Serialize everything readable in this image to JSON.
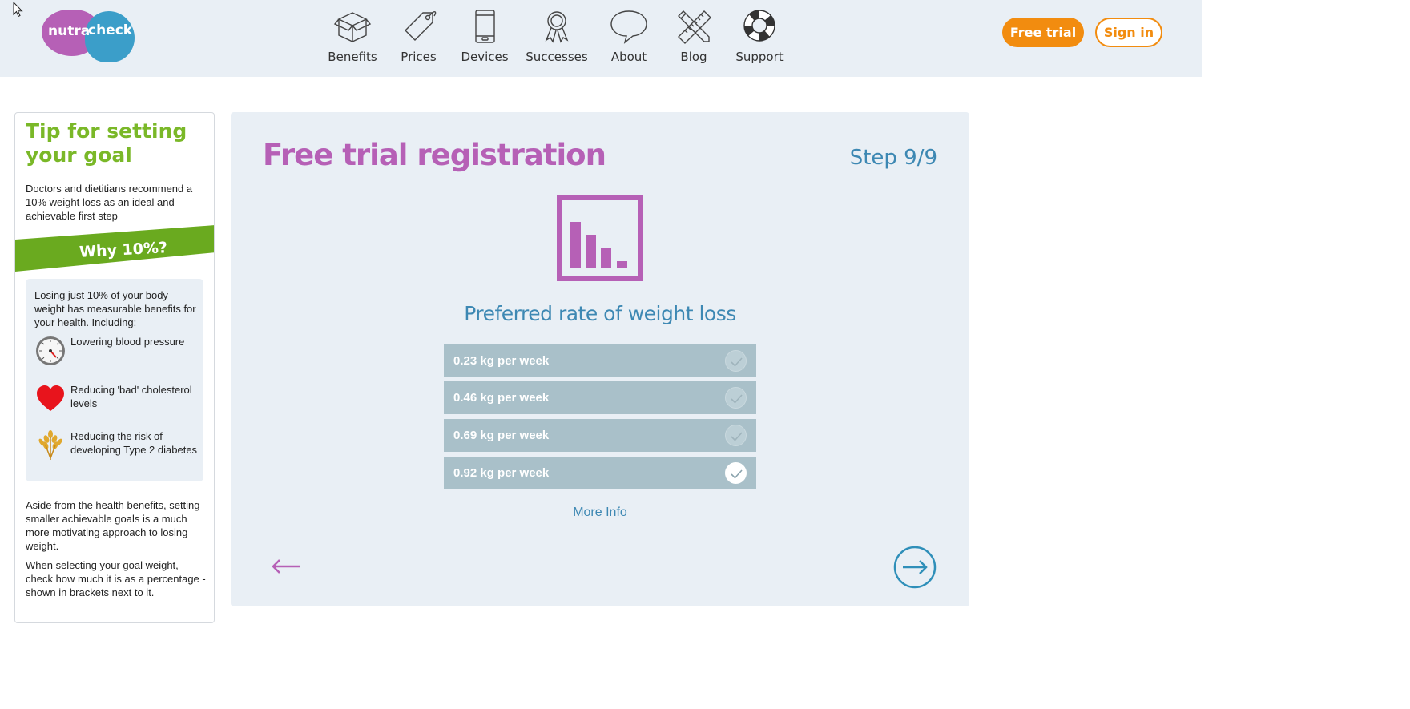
{
  "logo": {
    "part1": "nutra",
    "part2": "check"
  },
  "nav": [
    {
      "label": "Benefits",
      "icon": "box-icon"
    },
    {
      "label": "Prices",
      "icon": "price-tag-icon"
    },
    {
      "label": "Devices",
      "icon": "phone-icon"
    },
    {
      "label": "Successes",
      "icon": "rosette-icon"
    },
    {
      "label": "About",
      "icon": "speech-bubble-icon"
    },
    {
      "label": "Blog",
      "icon": "pencil-ruler-icon"
    },
    {
      "label": "Support",
      "icon": "lifebuoy-icon"
    }
  ],
  "header_buttons": {
    "free_trial": "Free trial",
    "sign_in": "Sign in"
  },
  "tip": {
    "title": "Tip for setting your goal",
    "intro": "Doctors and dietitians recommend a 10% weight loss as an ideal and achievable first step",
    "why": "Why 10%?",
    "benefits_intro": "Losing just 10% of your body weight has measurable benefits for your health. Including:",
    "benefits": [
      {
        "text": "Lowering blood pressure",
        "icon": "blood-pressure-gauge-icon"
      },
      {
        "text": "Reducing 'bad' cholesterol levels",
        "icon": "heart-icon"
      },
      {
        "text": "Reducing the risk of developing Type 2 diabetes",
        "icon": "wheat-icon"
      }
    ],
    "outro1": "Aside from the health benefits, setting smaller achievable goals is a much more motivating approach to losing weight.",
    "outro2": "When selecting your goal weight, check how much it is as a percentage - shown in brackets next to it."
  },
  "registration": {
    "title": "Free trial registration",
    "step": "Step 9/9",
    "question": "Preferred rate of weight loss",
    "options": [
      {
        "label": "0.23 kg per week",
        "selected": false
      },
      {
        "label": "0.46 kg per week",
        "selected": false
      },
      {
        "label": "0.69 kg per week",
        "selected": false
      },
      {
        "label": "0.92 kg per week",
        "selected": true
      }
    ],
    "more_info": "More Info"
  },
  "colors": {
    "brand_purple": "#b660b6",
    "brand_blue": "#3b9ec9",
    "accent_orange": "#f28c0f",
    "tip_green": "#7ab828",
    "option_bg": "#a9c0c9",
    "panel_bg": "#e9eff5"
  }
}
